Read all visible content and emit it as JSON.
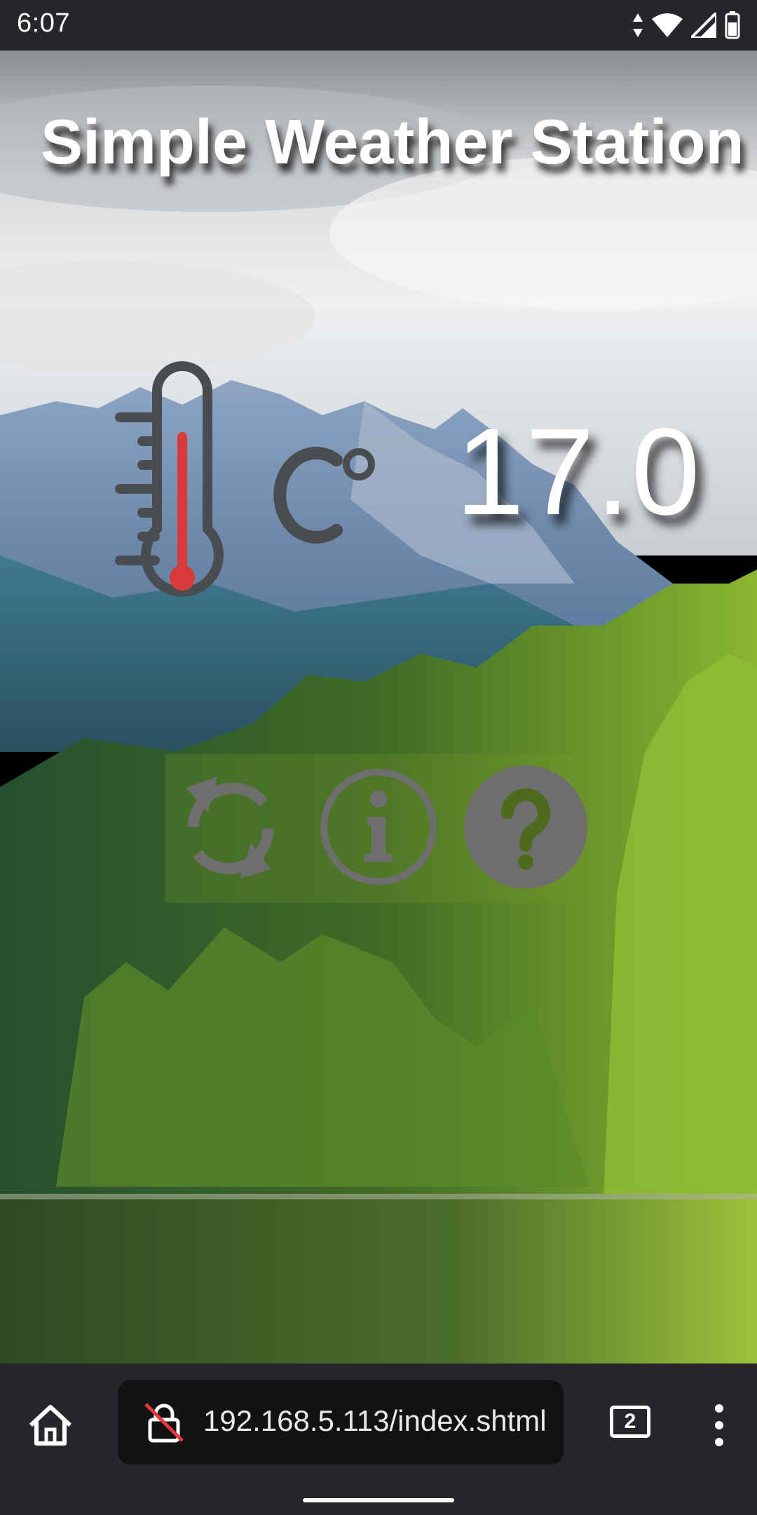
{
  "status_bar": {
    "time": "6:07",
    "icons": [
      "data-arrows-icon",
      "wifi-icon",
      "signal-icon",
      "battery-icon"
    ]
  },
  "page": {
    "title": "Simple Weather Station",
    "temperature": {
      "value": "17.0",
      "unit_icon": "celsius-icon",
      "icon": "thermometer-icon"
    },
    "buttons": [
      {
        "icon": "refresh-icon"
      },
      {
        "icon": "info-icon"
      },
      {
        "icon": "help-icon"
      }
    ],
    "colors": {
      "title": "#ffffff",
      "icon_gray": "#55575a",
      "thermo_red": "#d83a3a",
      "button_gray": "#6e6e6e"
    }
  },
  "browser": {
    "url": "192.168.5.113/index.shtml",
    "tab_count": "2",
    "icons": [
      "home-icon",
      "not-secure-lock-icon",
      "tabs-icon",
      "more-menu-icon"
    ]
  }
}
